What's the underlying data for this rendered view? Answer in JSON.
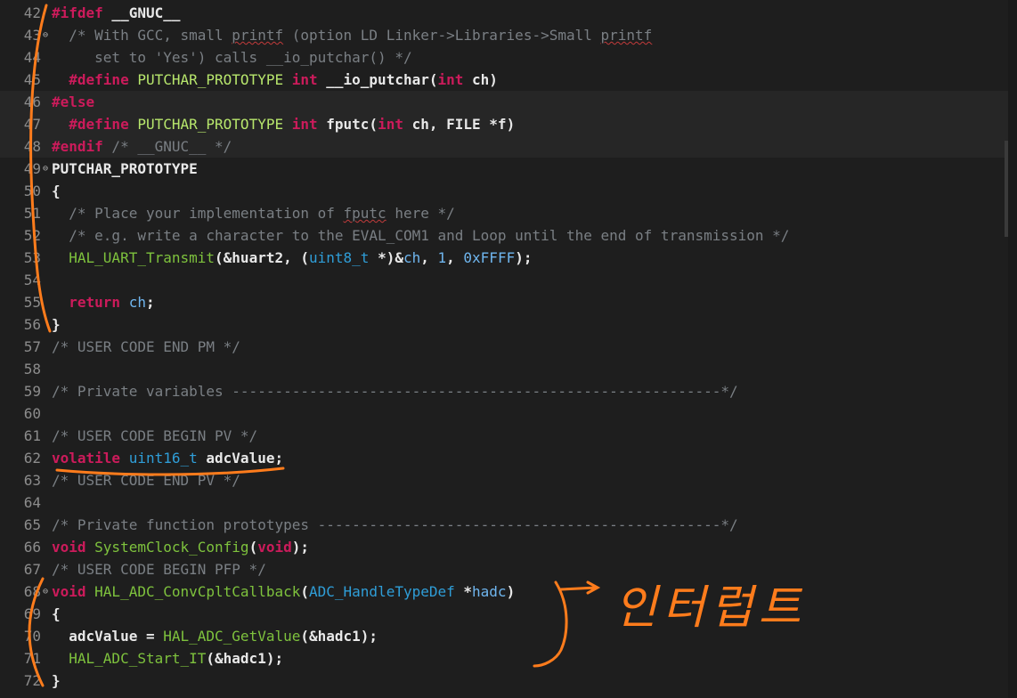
{
  "editor": {
    "lines": [
      {
        "n": "42",
        "fold": "",
        "inactive": false,
        "segs": [
          [
            "pp",
            "#ifdef"
          ],
          [
            "id",
            " __GNUC__"
          ]
        ]
      },
      {
        "n": "43",
        "fold": "⊖",
        "inactive": false,
        "segs": [
          [
            "cm",
            "  /* With GCC, small "
          ],
          [
            "cm sq",
            "printf"
          ],
          [
            "cm",
            " (option LD Linker->Libraries->Small "
          ],
          [
            "cm sq",
            "printf"
          ]
        ]
      },
      {
        "n": "44",
        "fold": "",
        "inactive": false,
        "segs": [
          [
            "cm",
            "     set to 'Yes') calls __io_putchar() */"
          ]
        ]
      },
      {
        "n": "45",
        "fold": "",
        "inactive": false,
        "segs": [
          [
            "pp",
            "  #define"
          ],
          [
            "mac",
            " PUTCHAR_PROTOTYPE"
          ],
          [
            "kw",
            " int"
          ],
          [
            "id",
            " __io_putchar("
          ],
          [
            "kw",
            "int"
          ],
          [
            "id",
            " ch)"
          ]
        ]
      },
      {
        "n": "46",
        "fold": "",
        "inactive": true,
        "segs": [
          [
            "pp",
            "#else"
          ]
        ]
      },
      {
        "n": "47",
        "fold": "",
        "inactive": true,
        "segs": [
          [
            "pp",
            "  #define"
          ],
          [
            "mac",
            " PUTCHAR_PROTOTYPE"
          ],
          [
            "kw",
            " int"
          ],
          [
            "id",
            " fputc("
          ],
          [
            "kw",
            "int"
          ],
          [
            "id",
            " ch, FILE *f)"
          ]
        ]
      },
      {
        "n": "48",
        "fold": "",
        "inactive": true,
        "segs": [
          [
            "pp",
            "#endif"
          ],
          [
            "cm",
            " /* __GNUC__ */"
          ]
        ]
      },
      {
        "n": "49",
        "fold": "⊖",
        "inactive": false,
        "segs": [
          [
            "id",
            "PUTCHAR_PROTOTYPE"
          ]
        ]
      },
      {
        "n": "50",
        "fold": "",
        "inactive": false,
        "segs": [
          [
            "id",
            "{"
          ]
        ]
      },
      {
        "n": "51",
        "fold": "",
        "inactive": false,
        "segs": [
          [
            "cm",
            "  /* Place your implementation of "
          ],
          [
            "cm sq",
            "fputc"
          ],
          [
            "cm",
            " here */"
          ]
        ]
      },
      {
        "n": "52",
        "fold": "",
        "inactive": false,
        "segs": [
          [
            "cm",
            "  /* e.g. write a character to the EVAL_COM1 and Loop until the end of transmission */"
          ]
        ]
      },
      {
        "n": "53",
        "fold": "",
        "inactive": false,
        "segs": [
          [
            "fn",
            "  HAL_UART_Transmit"
          ],
          [
            "id",
            "(&huart2, ("
          ],
          [
            "ty",
            "uint8_t"
          ],
          [
            "id",
            " *)&"
          ],
          [
            "nm",
            "ch"
          ],
          [
            "id",
            ", "
          ],
          [
            "nm",
            "1"
          ],
          [
            "id",
            ", "
          ],
          [
            "nm",
            "0xFFFF"
          ],
          [
            "id",
            ");"
          ]
        ]
      },
      {
        "n": "54",
        "fold": "",
        "inactive": false,
        "segs": []
      },
      {
        "n": "55",
        "fold": "",
        "inactive": false,
        "segs": [
          [
            "kw",
            "  return"
          ],
          [
            "nm",
            " ch"
          ],
          [
            "id",
            ";"
          ]
        ]
      },
      {
        "n": "56",
        "fold": "",
        "inactive": false,
        "segs": [
          [
            "id",
            "}"
          ]
        ]
      },
      {
        "n": "57",
        "fold": "",
        "inactive": false,
        "segs": [
          [
            "cm",
            "/* USER CODE END PM */"
          ]
        ]
      },
      {
        "n": "58",
        "fold": "",
        "inactive": false,
        "segs": []
      },
      {
        "n": "59",
        "fold": "",
        "inactive": false,
        "segs": [
          [
            "cm",
            "/* Private variables ---------------------------------------------------------*/"
          ]
        ]
      },
      {
        "n": "60",
        "fold": "",
        "inactive": false,
        "segs": []
      },
      {
        "n": "61",
        "fold": "",
        "inactive": false,
        "segs": [
          [
            "cm",
            "/* USER CODE BEGIN PV */"
          ]
        ]
      },
      {
        "n": "62",
        "fold": "",
        "inactive": false,
        "segs": [
          [
            "kw",
            "volatile"
          ],
          [
            "ty",
            " uint16_t"
          ],
          [
            "id",
            " adcValue;"
          ]
        ]
      },
      {
        "n": "63",
        "fold": "",
        "inactive": false,
        "segs": [
          [
            "cm",
            "/* USER CODE END PV */"
          ]
        ]
      },
      {
        "n": "64",
        "fold": "",
        "inactive": false,
        "segs": []
      },
      {
        "n": "65",
        "fold": "",
        "inactive": false,
        "segs": [
          [
            "cm",
            "/* Private function prototypes -----------------------------------------------*/"
          ]
        ]
      },
      {
        "n": "66",
        "fold": "",
        "inactive": false,
        "segs": [
          [
            "kw",
            "void"
          ],
          [
            "fn",
            " SystemClock_Config"
          ],
          [
            "id",
            "("
          ],
          [
            "kw",
            "void"
          ],
          [
            "id",
            ");"
          ]
        ]
      },
      {
        "n": "67",
        "fold": "",
        "inactive": false,
        "segs": [
          [
            "cm",
            "/* USER CODE BEGIN PFP */"
          ]
        ]
      },
      {
        "n": "68",
        "fold": "⊖",
        "inactive": false,
        "segs": [
          [
            "kw",
            "void"
          ],
          [
            "fn",
            " HAL_ADC_ConvCpltCallback"
          ],
          [
            "id",
            "("
          ],
          [
            "ty",
            "ADC_HandleTypeDef"
          ],
          [
            "id",
            " *"
          ],
          [
            "nm",
            "hadc"
          ],
          [
            "id",
            ")"
          ]
        ]
      },
      {
        "n": "69",
        "fold": "",
        "inactive": false,
        "segs": [
          [
            "id",
            "{"
          ]
        ]
      },
      {
        "n": "70",
        "fold": "",
        "inactive": false,
        "segs": [
          [
            "id",
            "  adcValue = "
          ],
          [
            "fn",
            "HAL_ADC_GetValue"
          ],
          [
            "id",
            "(&hadc1);"
          ]
        ]
      },
      {
        "n": "71",
        "fold": "",
        "inactive": false,
        "segs": [
          [
            "fn",
            "  HAL_ADC_Start_IT"
          ],
          [
            "id",
            "(&hadc1);"
          ]
        ]
      },
      {
        "n": "72",
        "fold": "",
        "inactive": false,
        "segs": [
          [
            "id",
            "}"
          ]
        ]
      }
    ]
  },
  "annotations": {
    "handwriting": "인터럽트",
    "ink_color": "#ff7c1c"
  }
}
